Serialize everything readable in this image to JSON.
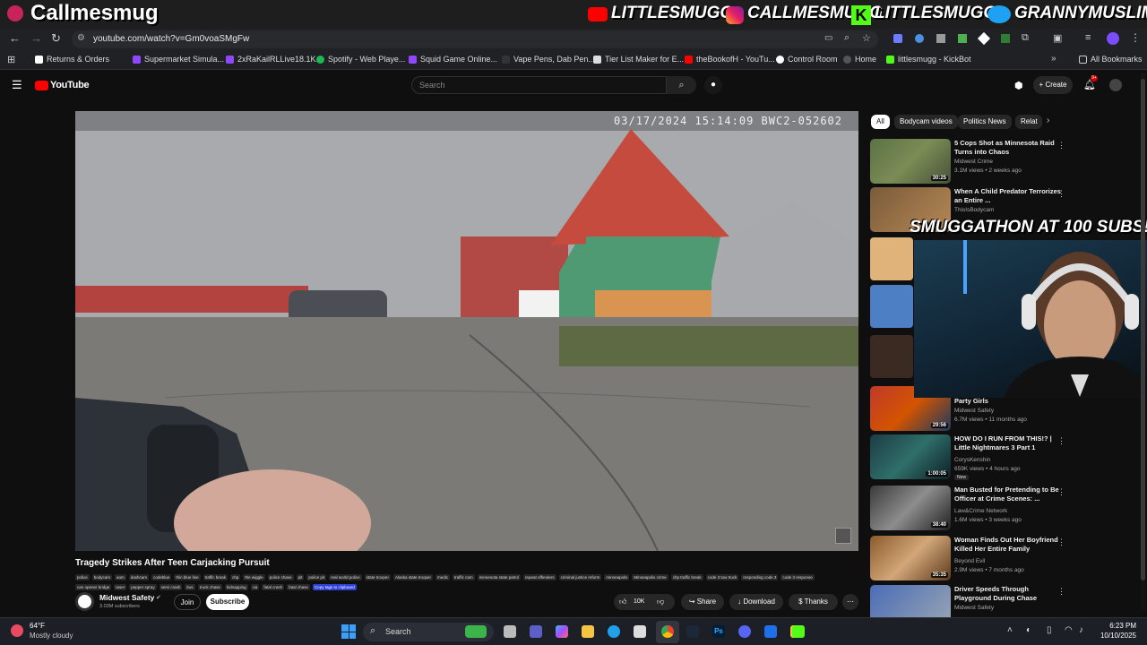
{
  "stream_overlay": {
    "title": "Callmesmug",
    "tiktok": "LITTLESMUGG",
    "instagram": "CALLMESMUGG",
    "kick": "LITTLESMUGG",
    "twitter": "GRANNYMUSLIM",
    "banner": "SMUGGATHON AT 100 SUBS!"
  },
  "browser": {
    "url": "youtube.com/watch?v=Gm0voaSMgFw",
    "bookmarks": [
      "Returns & Orders",
      "Supermarket Simula...",
      "2xRaKailRLLive18.1K...",
      "Spotify - Web Playe...",
      "Squid Game Online...",
      "Vape Pens, Dab Pen...",
      "Tier List Maker for E...",
      "theBookofH - YouTu...",
      "Control Room",
      "Home",
      "littlesmugg - KickBot"
    ],
    "all_bookmarks": "All Bookmarks"
  },
  "youtube": {
    "logo": "YouTube",
    "search_placeholder": "Search",
    "create_label": "Create",
    "notif_count": "9+"
  },
  "video": {
    "timestamp_overlay": "03/17/2024 15:14:09 BWC2-052602",
    "title": "Tragedy Strikes After Teen Carjacking Pursuit",
    "tags": [
      "police",
      "bodycam",
      "aom",
      "dashcam",
      "codeblue",
      "thin blue line",
      "traffic break",
      "chp",
      "the wiggle",
      "police chase",
      "pit",
      "police pit",
      "real world police",
      "state trooper",
      "Alaska state trooper",
      "medic",
      "traffic cam",
      "minnesota state patrol",
      "repeat offenders",
      "criminal justice reform",
      "minneapolis",
      "Minneapolis crime",
      "chp traffic break",
      "code 3 tow truck",
      "responding code 3",
      "code 3 response",
      "can opener bridge",
      "taser",
      "pepper spray",
      "semi crash",
      "iiwc",
      "truck chase",
      "kidnapping",
      "cia",
      "fatal crash",
      "fatal chase"
    ],
    "copy_tags": "Copy tags to clipboard",
    "channel": "Midwest Safety",
    "subscribers": "3.03M subscribers",
    "join": "Join",
    "subscribe": "Subscribe",
    "likes": "10K",
    "share": "Share",
    "download": "Download",
    "thanks": "Thanks"
  },
  "sidebar": {
    "chips": [
      "All",
      "Bodycam videos",
      "Politics News",
      "Relat"
    ],
    "items": [
      {
        "title": "5 Cops Shot as Minnesota Raid Turns into Chaos",
        "channel": "Midwest Crime",
        "meta": "3.1M views • 2 weeks ago",
        "duration": "30:25"
      },
      {
        "title": "When A Child Predator Terrorizes an Entire ...",
        "channel": "ThisIsBodycam",
        "meta": "",
        "duration": ""
      },
      {
        "title": "Party Girls",
        "channel": "Midwest Safety",
        "meta": "6.7M views • 11 months ago",
        "duration": "29:56"
      },
      {
        "title": "HOW DO I RUN FROM THIS!? | Little Nightmares 3 Part 1",
        "channel": "CorysKenshin",
        "meta": "659K views • 4 hours ago",
        "duration": "1:00:05",
        "badge": "New"
      },
      {
        "title": "Man Busted for Pretending to Be Officer at Crime Scenes: ...",
        "channel": "Law&Crime Network",
        "meta": "1.6M views • 3 weeks ago",
        "duration": "38:40"
      },
      {
        "title": "Woman Finds Out Her Boyfriend Killed Her Entire Family",
        "channel": "Beyond Evil",
        "meta": "2.9M views • 7 months ago",
        "duration": "35:35"
      },
      {
        "title": "Driver Speeds Through Playground During Chase",
        "channel": "Midwest Safety",
        "meta": "",
        "duration": ""
      }
    ]
  },
  "taskbar": {
    "weather_temp": "64°F",
    "weather_desc": "Mostly cloudy",
    "search": "Search",
    "time": "6:23 PM",
    "date": "10/10/2025"
  },
  "colors": {
    "yt_red": "#ff0000",
    "accent_blue": "#3ea6ff"
  }
}
